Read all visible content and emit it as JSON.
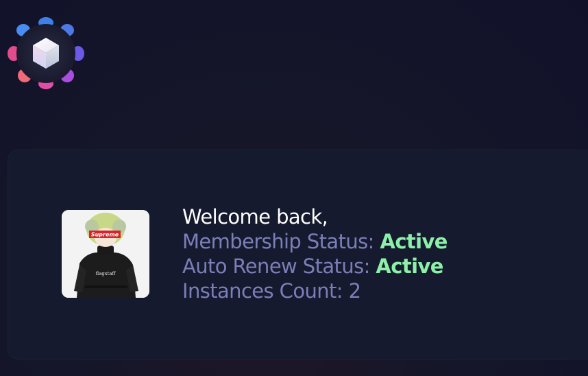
{
  "app": {
    "logo_icon": "hexagon-cube-logo-icon"
  },
  "profile": {
    "avatar_icon": "user-avatar",
    "avatar_print": "Supreme",
    "shirt_print": "flagstaff",
    "welcome": "Welcome back,",
    "membership_label": "Membership Status: ",
    "membership_value": "Active",
    "autorenew_label": "Auto Renew Status: ",
    "autorenew_value": "Active",
    "instances_label": "Instances Count: ",
    "instances_value": "2"
  },
  "colors": {
    "background": "#151629",
    "card": "#161a2e",
    "label": "#7b7fb8",
    "status_active": "#8cf0a8",
    "text_primary": "#ffffff"
  }
}
